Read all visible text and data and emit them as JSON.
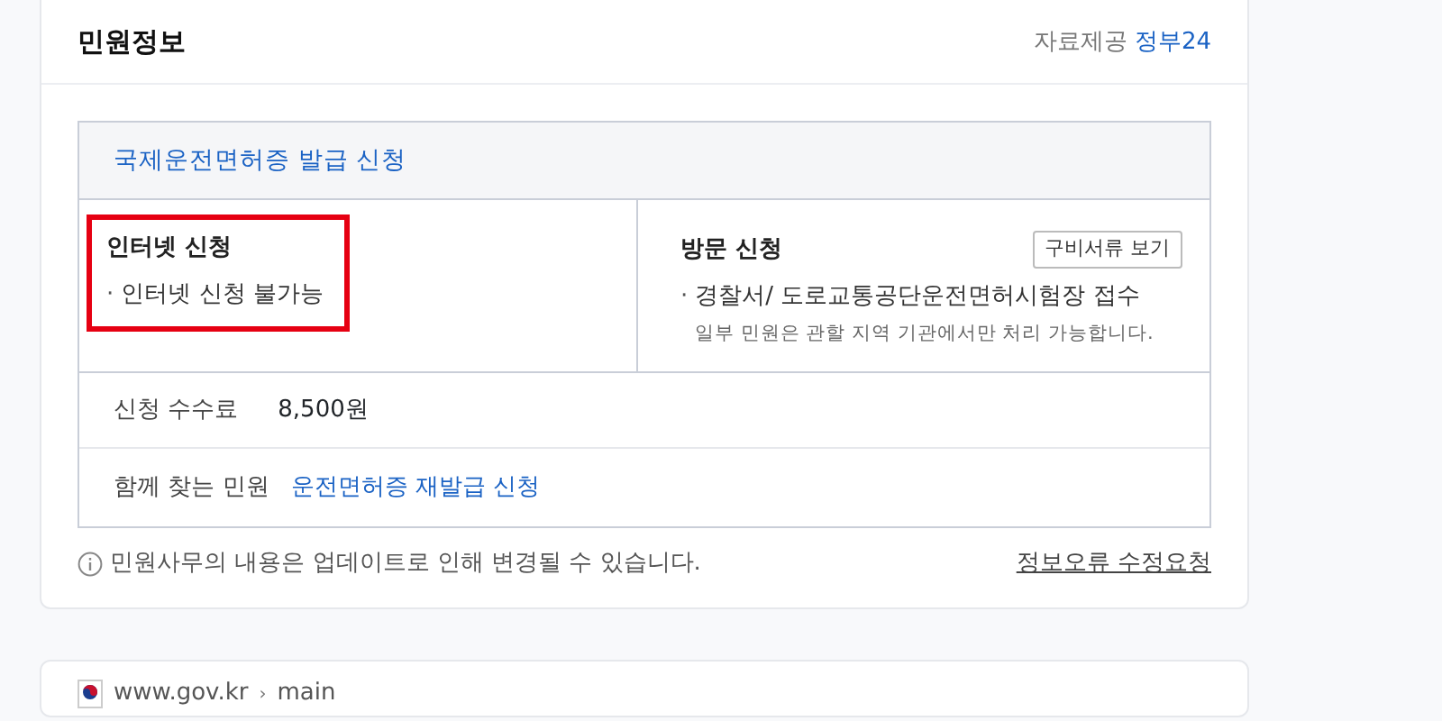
{
  "section": {
    "title": "민원정보",
    "source_label": "자료제공",
    "source_link": "정부24"
  },
  "service": {
    "title": "국제운전면허증 발급 신청",
    "methods": [
      {
        "title": "인터넷 신청",
        "highlighted": true,
        "bullet": "·",
        "items": [
          "인터넷 신청 불가능"
        ]
      },
      {
        "title": "방문 신청",
        "highlighted": false,
        "button": "구비서류 보기",
        "bullet": "·",
        "items": [
          "경찰서/ 도로교통공단운전면허시험장 접수"
        ],
        "note": "일부 민원은 관할 지역 기관에서만 처리 가능합니다."
      }
    ],
    "fee_label": "신청 수수료",
    "fee": "8,500원",
    "related_label": "함께 찾는 민원",
    "related_link": "운전면허증 재발급 신청"
  },
  "notice": "민원사무의 내용은 업데이트로 인해 변경될 수 있습니다.",
  "report_link": "정보오류 수정요청",
  "breadcrumb": {
    "site": "www.gov.kr",
    "separator": "›",
    "path": "main"
  }
}
